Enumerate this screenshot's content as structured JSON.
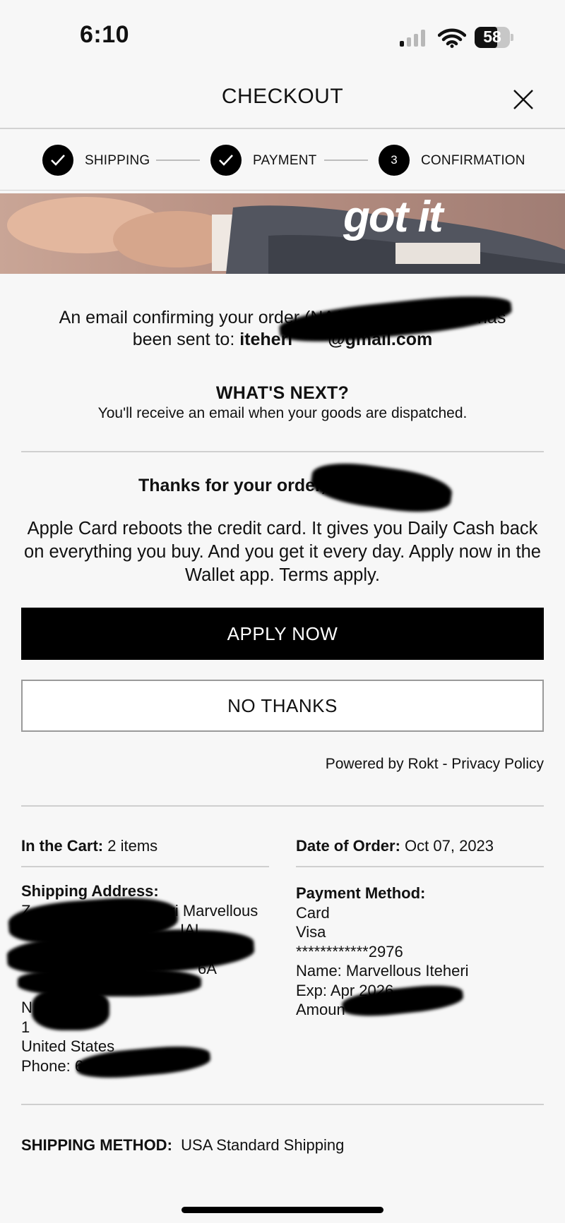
{
  "status_bar": {
    "time": "6:10",
    "battery": "58"
  },
  "header": {
    "title": "CHECKOUT"
  },
  "steps": [
    {
      "label": "SHIPPING",
      "state": "done"
    },
    {
      "label": "PAYMENT",
      "state": "done"
    },
    {
      "number": "3",
      "label": "CONFIRMATION",
      "state": "current"
    }
  ],
  "banner": {
    "text": "got it"
  },
  "confirmation": {
    "email_prefix": "An email confirming your order (NA1U",
    "email_suffix": "has",
    "sent_to_label": "been sent to: ",
    "sent_to_value": "iteheri",
    "sent_to_domain": "@gmail.com",
    "whats_next_title": "WHAT'S NEXT?",
    "whats_next_text": "You'll receive an email when your goods are dispatched."
  },
  "offer": {
    "thanks": "Thanks for your order,",
    "text": "Apple Card reboots the credit card. It gives you Daily Cash back on everything you buy. And you get it every day. Apply now in the Wallet app. Terms apply.",
    "apply_label": "APPLY NOW",
    "decline_label": "NO THANKS",
    "powered_by": "Powered by Rokt - Privacy Policy"
  },
  "order": {
    "cart_label": "In the Cart:",
    "cart_value": "2 items",
    "date_label": "Date of Order:",
    "date_value": "Oct 07, 2023",
    "shipping_address_label": "Shipping Address:",
    "shipping_address_lines": [
      "Z",
      "ss Iteheri Marvellous",
      "IAL",
      "6A",
      "N",
      "1",
      "United States",
      "Phone: 64"
    ],
    "payment_label": "Payment Method:",
    "payment_lines": [
      "Card",
      "Visa",
      "************2976",
      "Name: Marvellous Iteheri",
      "Exp: Apr 2026",
      "Amoun"
    ],
    "shipping_method_label": "SHIPPING METHOD:",
    "shipping_method_value": "USA Standard Shipping"
  }
}
